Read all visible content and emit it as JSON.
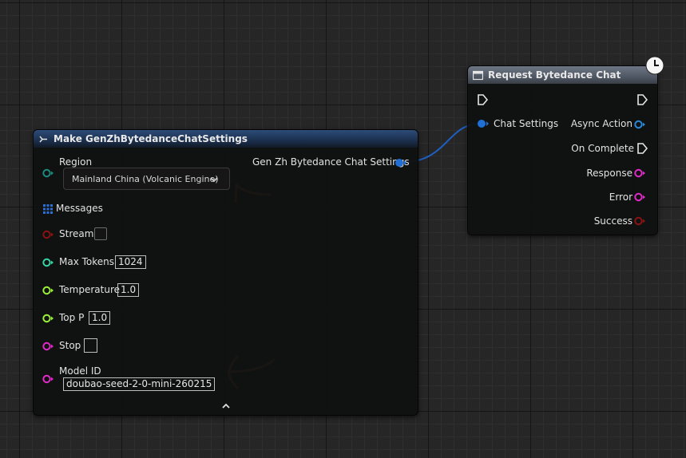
{
  "make_node": {
    "title": "Make GenZhBytedanceChatSettings",
    "output_label": "Gen Zh Bytedance Chat Settings",
    "region_label": "Region",
    "region_value": "Mainland China (Volcanic Engine)",
    "messages_label": "Messages",
    "stream_label": "Stream",
    "max_tokens_label": "Max Tokens",
    "max_tokens_value": "1024",
    "temperature_label": "Temperature",
    "temperature_value": "1.0",
    "top_p_label": "Top P",
    "top_p_value": "1.0",
    "stop_label": "Stop",
    "model_id_label": "Model ID",
    "model_id_value": "doubao-seed-2-0-mini-260215"
  },
  "request_node": {
    "title": "Request Bytedance Chat",
    "chat_settings_label": "Chat Settings",
    "async_action_label": "Async Action",
    "on_complete_label": "On Complete",
    "response_label": "Response",
    "error_label": "Error",
    "success_label": "Success"
  },
  "colors": {
    "struct_pin": "#1f6fd6",
    "byte_pin": "#1d8a7f",
    "bool_pin": "#8b1212",
    "int_pin": "#37d4a6",
    "float_pin": "#9bf13a",
    "string_pin": "#e02bc8",
    "annotation": "#f06a1d"
  },
  "icons": {
    "make_header": "make-struct-icon",
    "request_header": "function-icon",
    "latent": "clock-icon",
    "messages": "array-grid-icon",
    "collapse": "chevron-up-icon"
  }
}
